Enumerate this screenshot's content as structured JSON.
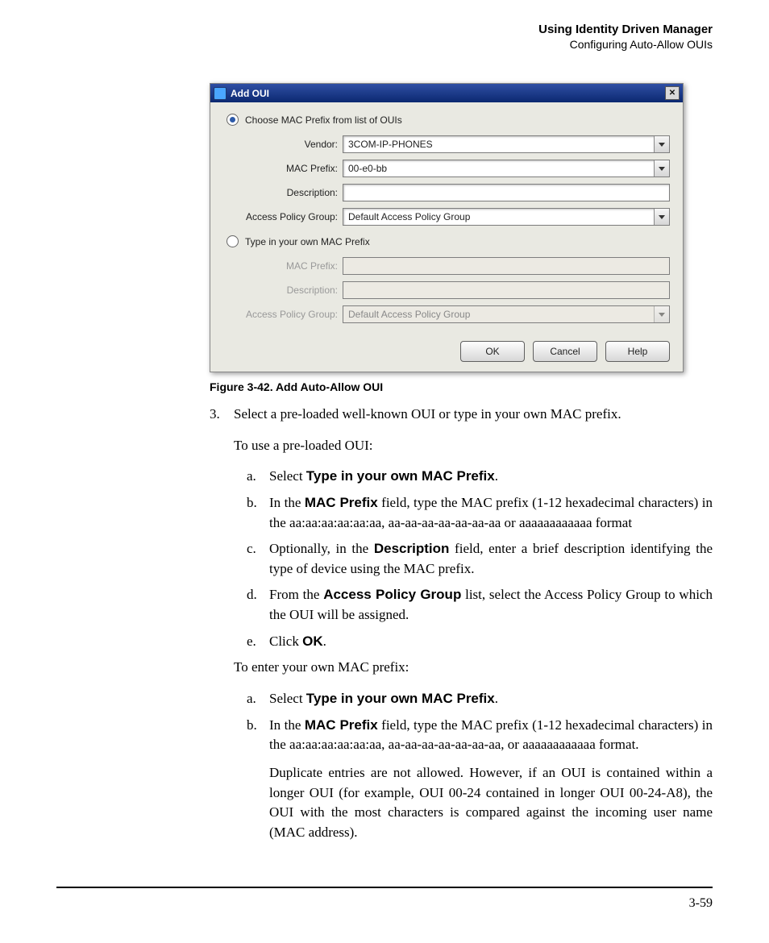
{
  "header": {
    "title": "Using Identity Driven Manager",
    "subtitle": "Configuring Auto-Allow OUIs"
  },
  "dialog": {
    "title": "Add OUI",
    "radio1_label": "Choose MAC Prefix from list of OUIs",
    "radio2_label": "Type in your own MAC Prefix",
    "labels": {
      "vendor": "Vendor:",
      "mac_prefix": "MAC Prefix:",
      "description": "Description:",
      "access_policy_group": "Access Policy Group:"
    },
    "values": {
      "vendor": "3COM-IP-PHONES",
      "mac_prefix": "00-e0-bb",
      "description": "",
      "access_policy_group": "Default Access Policy Group",
      "mac_prefix2": "",
      "description2": "",
      "access_policy_group2": "Default Access Policy Group"
    },
    "buttons": {
      "ok": "OK",
      "cancel": "Cancel",
      "help": "Help"
    }
  },
  "caption": "Figure 3-42. Add Auto-Allow OUI",
  "step3": {
    "marker": "3.",
    "p1": "Select a pre-loaded well-known OUI or type in your own MAC prefix.",
    "p2": "To use a pre-loaded OUI:",
    "a1": {
      "m": "a.",
      "pre": "Select ",
      "bold": "Type in your own MAC Prefix",
      "post": "."
    },
    "a2": {
      "m": "b.",
      "pre": "In the ",
      "bold": "MAC Prefix",
      "post": " field, type the MAC prefix (1-12 hexadecimal characters) in the aa:aa:aa:aa:aa:aa, aa-aa-aa-aa-aa-aa-aa or aaaaaaaaaaaa format"
    },
    "a3": {
      "m": "c.",
      "pre": "Optionally, in the ",
      "bold": "Description",
      "post": " field, enter a brief description identifying the type of device using the MAC prefix."
    },
    "a4": {
      "m": "d.",
      "pre": "From the ",
      "bold": "Access Policy Group",
      "post": " list, select the Access Policy Group to which the OUI will be assigned."
    },
    "a5": {
      "m": "e.",
      "pre": "Click ",
      "bold": "OK",
      "post": "."
    },
    "p3": "To enter your own MAC prefix:",
    "b1": {
      "m": "a.",
      "pre": "Select ",
      "bold": "Type in your own MAC Prefix",
      "post": "."
    },
    "b2": {
      "m": "b.",
      "pre": "In the ",
      "bold": "MAC Prefix",
      "post": " field, type the MAC prefix (1-12 hexadecimal characters) in the aa:aa:aa:aa:aa:aa, aa-aa-aa-aa-aa-aa-aa, or aaaaaaaaaaaa format."
    },
    "b2_extra": "Duplicate entries are not allowed. However, if an OUI is contained within a longer OUI (for example, OUI 00-24 contained in longer OUI 00-24-A8), the OUI with the most characters is compared against the incoming user name (MAC address)."
  },
  "page_num": "3-59"
}
